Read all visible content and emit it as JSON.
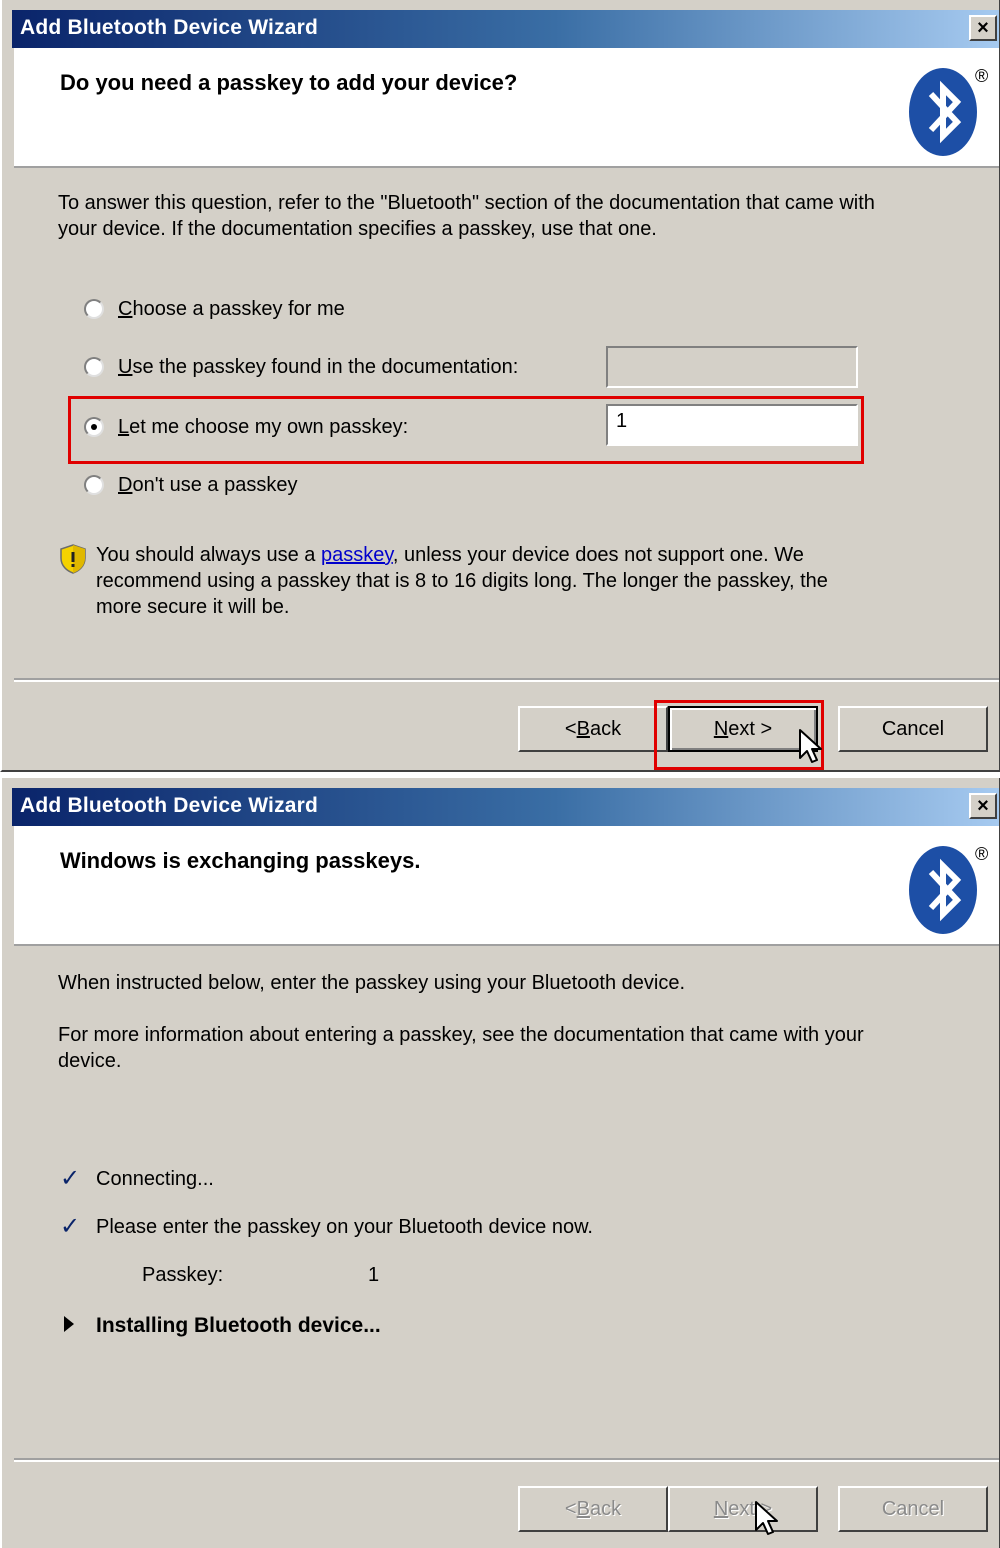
{
  "dialog1": {
    "window_title": "Add Bluetooth Device Wizard",
    "close": "×",
    "header_title": "Do you need a passkey to add your device?",
    "intro_line1": "To answer this question, refer to the \"Bluetooth\" section of the documentation that came with",
    "intro_line2": "your device. If the documentation specifies a passkey, use that one.",
    "options": [
      {
        "accel": "C",
        "rest": "hoose a passkey for me",
        "checked": false
      },
      {
        "accel": "U",
        "rest": "se the passkey found in the documentation:",
        "checked": false
      },
      {
        "accel": "L",
        "rest": "et me choose my own passkey:",
        "checked": true
      },
      {
        "accel": "D",
        "rest": "on't use a passkey",
        "checked": false
      }
    ],
    "documentation_passkey_value": "",
    "own_passkey_value": "1",
    "info_prefix": "You should always use a ",
    "info_link": "passkey",
    "info_suffix1": ", unless your device does not support one. We",
    "info_line2": "recommend using a passkey that is 8 to 16 digits long. The longer the passkey, the",
    "info_line3": "more secure it will be.",
    "buttons": {
      "back_pre": "< ",
      "back_accel": "B",
      "back_rest": "ack",
      "next_accel": "N",
      "next_rest": "ext >",
      "cancel": "Cancel"
    }
  },
  "dialog2": {
    "window_title": "Add Bluetooth Device Wizard",
    "close": "×",
    "header_title": "Windows is exchanging passkeys.",
    "line1": "When instructed below, enter the passkey using your Bluetooth device.",
    "line2a": "For more information about entering a passkey, see the documentation that came with your",
    "line2b": "device.",
    "status": [
      {
        "icon": "✓",
        "text": "Connecting..."
      },
      {
        "icon": "✓",
        "text": "Please enter the passkey on your Bluetooth device now."
      }
    ],
    "passkey_label": "Passkey:",
    "passkey_value": "1",
    "installing": "Installing Bluetooth device...",
    "buttons": {
      "back_pre": "< ",
      "back_accel": "B",
      "back_rest": "ack",
      "next_accel": "N",
      "next_rest": "ext >",
      "cancel": "Cancel"
    }
  },
  "colors": {
    "highlight": "#e00000",
    "bluetooth_blue": "#1d4fa6",
    "title_gradient_start": "#0a246a",
    "link": "#0000cc"
  },
  "icons": [
    "bluetooth-logo-icon",
    "shield-warning-icon",
    "checkmark-icon",
    "right-triangle-icon",
    "mouse-cursor-icon",
    "close-icon"
  ]
}
